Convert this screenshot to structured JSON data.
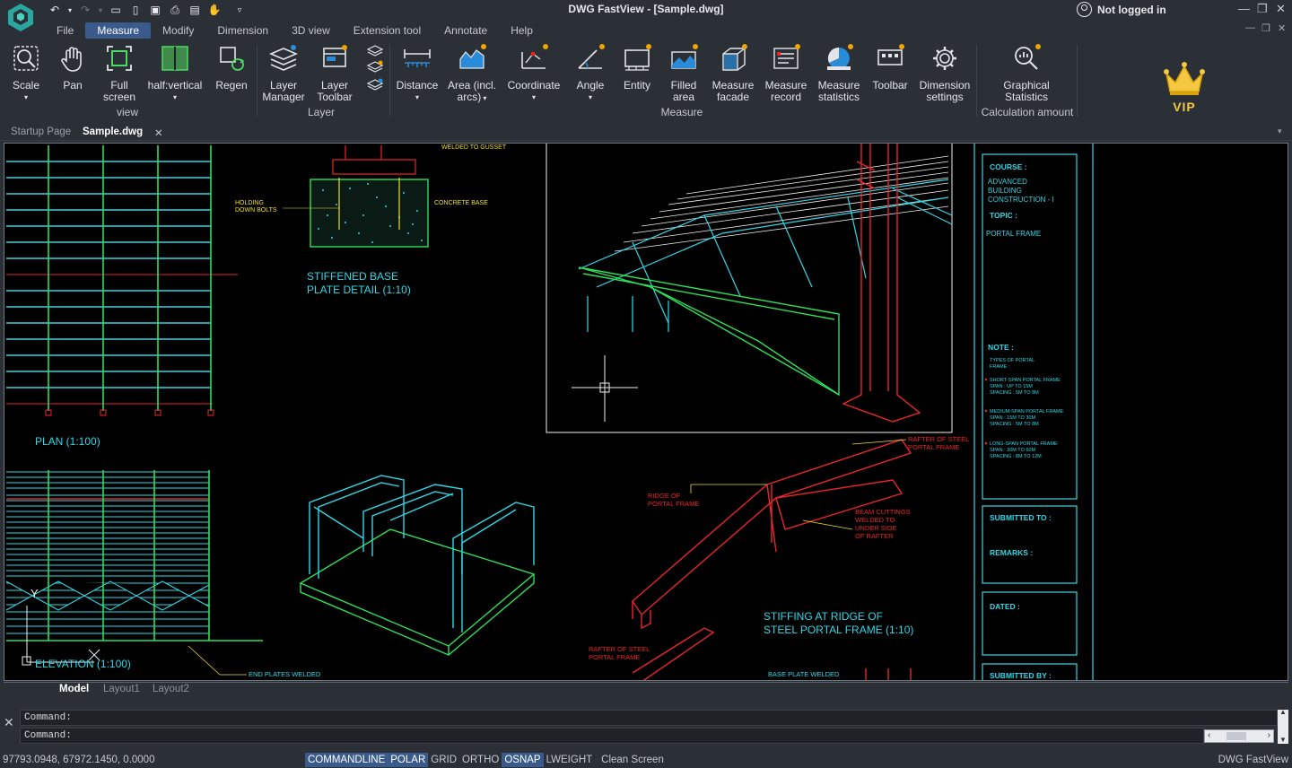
{
  "app": {
    "window_title": "DWG FastView - [Sample.dwg]",
    "user_status": "Not logged in",
    "brand": "DWG FastView",
    "accent_color": "#3a5a8c",
    "badge_color": "#f0a400"
  },
  "quick_access": {
    "icons": [
      "undo-icon",
      "undo-dropdown-icon",
      "redo-icon",
      "redo-dropdown-icon",
      "open-icon",
      "new-icon",
      "save-icon",
      "print-icon",
      "export-icon",
      "pan-hand-icon",
      "customize-dropdown-icon"
    ]
  },
  "menu": {
    "items": [
      "File",
      "Measure",
      "Modify",
      "Dimension",
      "3D view",
      "Extension tool",
      "Annotate",
      "Help"
    ],
    "active": "Measure"
  },
  "ribbon": {
    "view": {
      "group_label": "view",
      "scale": "Scale",
      "pan": "Pan",
      "full_screen_1": "Full",
      "full_screen_2": "screen",
      "half_vertical": "half:vertical",
      "regen": "Regen"
    },
    "layer": {
      "group_label": "Layer",
      "manager_1": "Layer",
      "manager_2": "Manager",
      "toolbar_1": "Layer",
      "toolbar_2": "Toolbar"
    },
    "measure": {
      "group_label": "Measure",
      "distance": "Distance",
      "area_1": "Area (incl.",
      "area_2": "arcs)",
      "coordinate": "Coordinate",
      "angle": "Angle",
      "entity": "Entity",
      "filled_1": "Filled",
      "filled_2": "area",
      "facade_1": "Measure",
      "facade_2": "facade",
      "record_1": "Measure",
      "record_2": "record",
      "statistics_1": "Measure",
      "statistics_2": "statistics",
      "toolbar": "Toolbar",
      "dimset_1": "Dimension",
      "dimset_2": "settings"
    },
    "calc": {
      "group_label": "Calculation amount",
      "graphical_1": "Graphical",
      "graphical_2": "Statistics"
    },
    "vip": "VIP"
  },
  "doc_tabs": [
    "Startup Page",
    "Sample.dwg"
  ],
  "active_doc": "Sample.dwg",
  "drawing": {
    "labels": {
      "holding_bolts_1": "HOLDING",
      "holding_bolts_2": "DOWN BOLTS",
      "concrete_base": "CONCRETE BASE",
      "welded_top": "WELDED TO GUSSET",
      "stiffened_1": "STIFFENED BASE",
      "stiffened_2": "PLATE DETAIL (1:10)",
      "plan": "PLAN (1:100)",
      "elevation": "ELEVATION   (1:100)",
      "ridge_1": "RIDGE OF",
      "ridge_2": "PORTAL FRAME",
      "rafter_steel_1": "RAFTER OF STEEL",
      "rafter_steel_2": "PORTAL FRAME",
      "beam_cut_1": "BEAM CUTTINGS",
      "beam_cut_2": "WELDED TO",
      "beam_cut_3": "UNDER SIDE",
      "beam_cut_4": "OF RAFTER",
      "stiffing_1": "STIFFING AT RIDGE OF",
      "stiffing_2": "STEEL PORTAL FRAME (1:10)",
      "rafter_lower_1": "RAFTER OF STEEL",
      "rafter_lower_2": "PORTAL FRAME",
      "end_plates": "END PLATES WELDED",
      "base_plate": "BASE PLATE WELDED",
      "y_axis": "Y"
    },
    "title_block": {
      "course_label": "COURSE :",
      "course_1": "ADVANCED",
      "course_2": "BUILDING",
      "course_3": "CONSTRUCTION - I",
      "topic_label": "TOPIC :",
      "topic": "PORTAL FRAME",
      "note_label": "NOTE :",
      "note_types_1": "TYPES OF PORTAL",
      "note_types_2": "FRAME :",
      "short_1": "SHORT-SPAN PORTAL FRAME",
      "short_2": "SPAN      : UP TO 15M",
      "short_3": "SPACING : 5M TO 8M",
      "medium_1": "MEDIUM-SPAN PORTAL FRAME",
      "medium_2": "SPAN      : 15M TO 30M",
      "medium_3": "SPACING : 5M TO 8M",
      "long_1": "LONG-SPAN PORTAL FRAME",
      "long_2": "SPAN      : 30M TO 60M",
      "long_3": "SPACING : 8M TO 12M",
      "submitted_to": "SUBMITTED TO :",
      "remarks": "REMARKS :",
      "dated": "DATED :",
      "submitted_by": "SUBMITTED BY :"
    },
    "colors": {
      "cyan": "#2fd8e8",
      "green": "#2ee05a",
      "red": "#e8262a",
      "yellow": "#f0e020",
      "white": "#f0f0f0"
    }
  },
  "layout_tabs": [
    "Model",
    "Layout1",
    "Layout2"
  ],
  "active_layout": "Model",
  "command": {
    "line1": "Command:",
    "line2": "Command:"
  },
  "status": {
    "coordinates": "97793.0948, 67972.1450, 0.0000",
    "toggles": [
      {
        "label": "COMMANDLINE",
        "on": true
      },
      {
        "label": "POLAR",
        "on": true
      },
      {
        "label": "GRID",
        "on": false
      },
      {
        "label": "ORTHO",
        "on": false
      },
      {
        "label": "OSNAP",
        "on": true
      },
      {
        "label": "LWEIGHT",
        "on": false
      },
      {
        "label": "Clean Screen",
        "on": false
      }
    ]
  }
}
